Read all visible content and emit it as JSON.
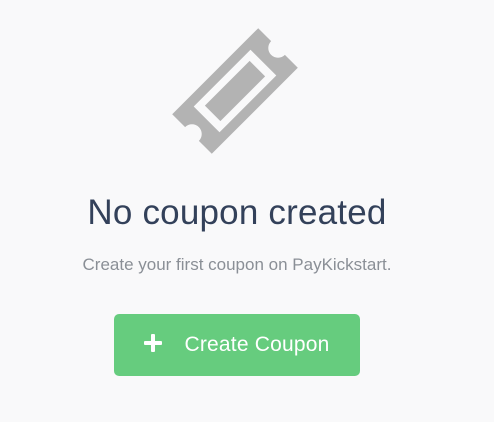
{
  "empty_state": {
    "icon": "coupon-ticket-icon",
    "title": "No coupon created",
    "subtitle": "Create your first coupon on PayKickstart.",
    "button": {
      "icon": "plus-icon",
      "label": "Create Coupon"
    }
  },
  "colors": {
    "background": "#f9f9fa",
    "icon": "#b3b3b3",
    "title": "#33415a",
    "subtitle": "#8a8f96",
    "button": "#66cc7e",
    "button_text": "#ffffff"
  }
}
